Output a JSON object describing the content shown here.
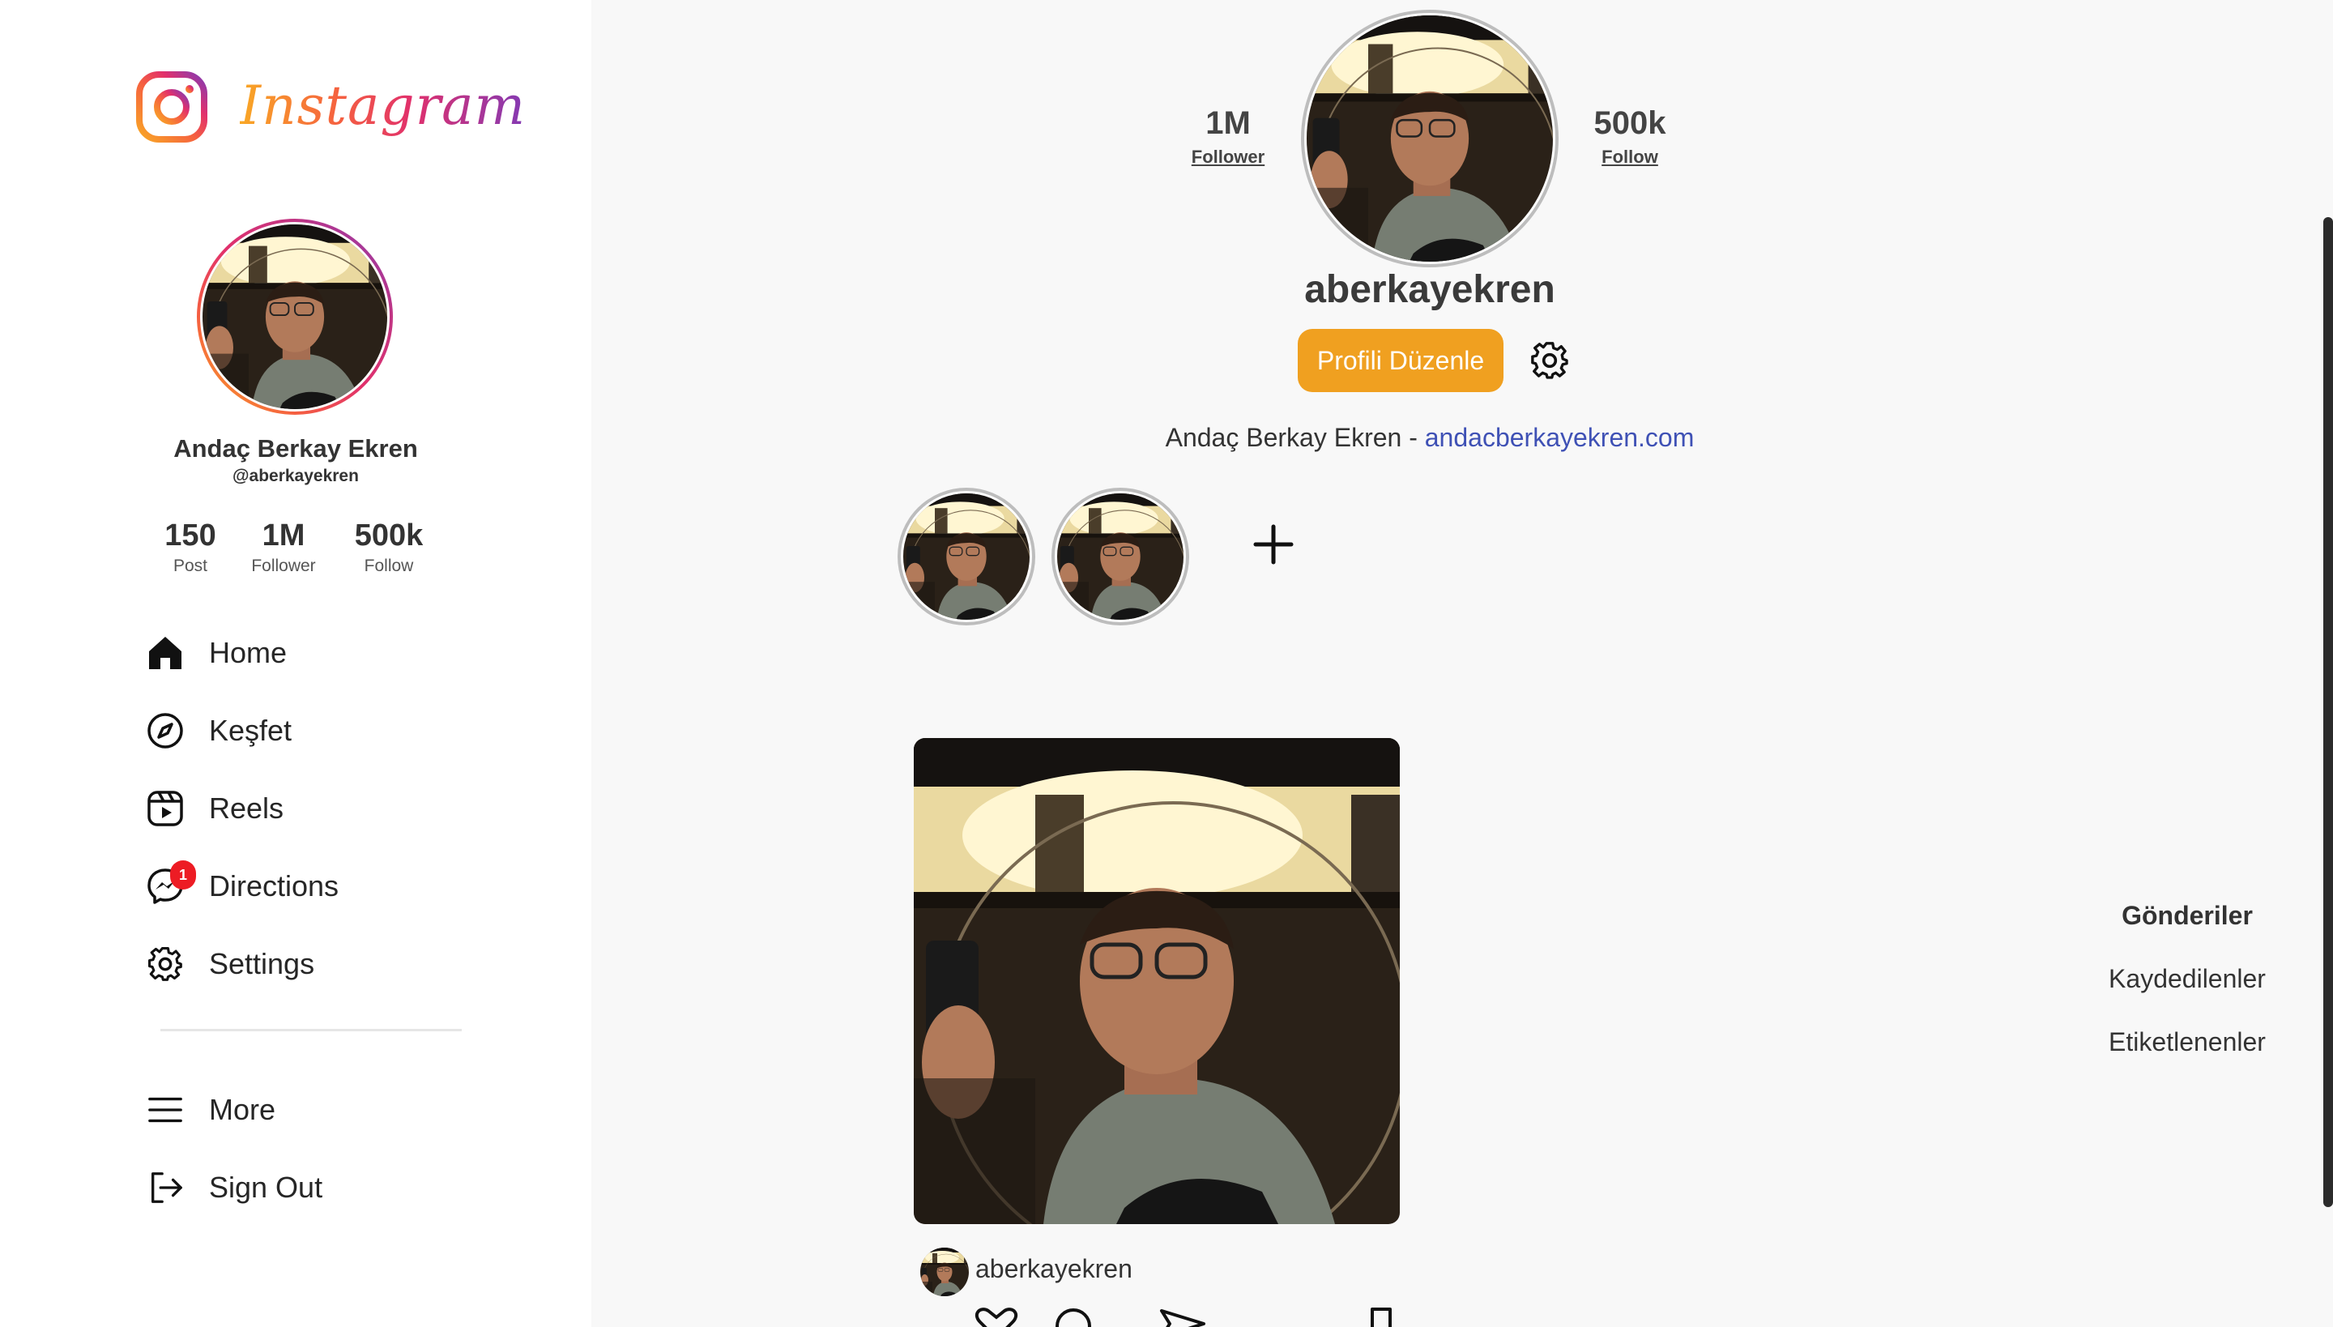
{
  "brand": {
    "wordmark": "Instagram"
  },
  "sidebar": {
    "name": "Andaç Berkay Ekren",
    "handle": "@aberkayekren",
    "stats": [
      {
        "value": "150",
        "label": "Post"
      },
      {
        "value": "1M",
        "label": "Follower"
      },
      {
        "value": "500k",
        "label": "Follow"
      }
    ],
    "nav": [
      {
        "label": "Home",
        "icon": "home-icon"
      },
      {
        "label": "Keşfet",
        "icon": "compass-icon"
      },
      {
        "label": "Reels",
        "icon": "reels-icon"
      },
      {
        "label": "Directions",
        "icon": "messenger-icon",
        "badge": "1"
      },
      {
        "label": "Settings",
        "icon": "gear-icon"
      }
    ],
    "bottom": [
      {
        "label": "More",
        "icon": "menu-icon"
      },
      {
        "label": "Sign Out",
        "icon": "sign-out-icon"
      }
    ]
  },
  "profile": {
    "username": "aberkayekren",
    "followers": {
      "value": "1M",
      "label": "Follower"
    },
    "following": {
      "value": "500k",
      "label": "Follow"
    },
    "edit_label": "Profili Düzenle",
    "bio_text": "Andaç Berkay Ekren - ",
    "bio_link": "andacberkayekren.com",
    "highlights_count": 2
  },
  "post": {
    "username": "aberkayekren"
  },
  "tabs": [
    {
      "label": "Gönderiler",
      "active": true
    },
    {
      "label": "Kaydedilenler",
      "active": false
    },
    {
      "label": "Etiketlenenler",
      "active": false
    }
  ],
  "colors": {
    "accent": "#f0a020",
    "link": "#3f51b5",
    "badge": "#ed1c24"
  }
}
